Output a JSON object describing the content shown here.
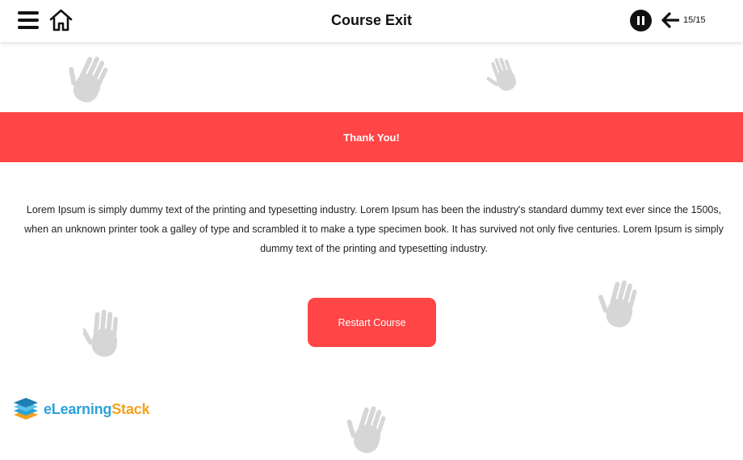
{
  "header": {
    "title": "Course Exit",
    "page_counter": "15/15",
    "icons": [
      "menu-icon",
      "home-icon",
      "pause-icon",
      "arrow-left-icon"
    ]
  },
  "banner": {
    "text": "Thank You!",
    "color": "#ff4545"
  },
  "main": {
    "body_text": "Lorem Ipsum is simply dummy text of the printing and typesetting industry. Lorem Ipsum has been the industry's standard dummy text ever since the 1500s, when an unknown printer took a galley of type and scrambled it to make a type specimen book. It has survived not only five centuries. Lorem Ipsum is simply dummy text of the printing and typesetting industry.",
    "restart_label": "Restart Course"
  },
  "logo": {
    "prefix": "eLearning",
    "suffix": "Stack",
    "colors": {
      "prefix": "#2ba3d8",
      "suffix": "#f5a11c"
    }
  },
  "decorations": [
    "hand-icon"
  ]
}
